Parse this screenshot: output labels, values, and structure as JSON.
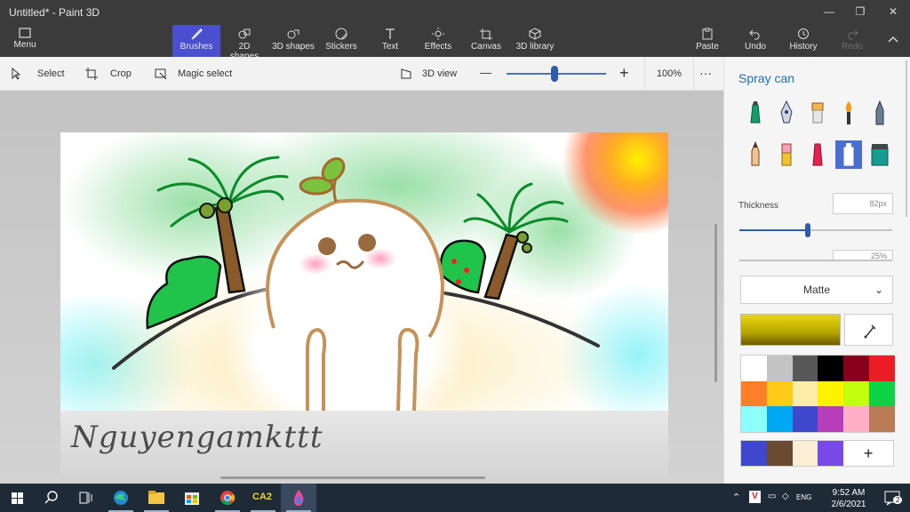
{
  "window": {
    "title": "Untitled* - Paint 3D"
  },
  "ribbon": {
    "menu": "Menu",
    "tabs": [
      {
        "id": "brushes",
        "label": "Brushes"
      },
      {
        "id": "2d-shapes",
        "label": "2D shapes"
      },
      {
        "id": "3d-shapes",
        "label": "3D shapes"
      },
      {
        "id": "stickers",
        "label": "Stickers"
      },
      {
        "id": "text",
        "label": "Text"
      },
      {
        "id": "effects",
        "label": "Effects"
      },
      {
        "id": "canvas",
        "label": "Canvas"
      },
      {
        "id": "3d-library",
        "label": "3D library"
      }
    ],
    "actions": [
      {
        "id": "paste",
        "label": "Paste"
      },
      {
        "id": "undo",
        "label": "Undo"
      },
      {
        "id": "history",
        "label": "History"
      },
      {
        "id": "redo",
        "label": "Redo"
      }
    ]
  },
  "toolbar": {
    "select": "Select",
    "crop": "Crop",
    "magic_select": "Magic select",
    "view_3d": "3D view",
    "zoom_out": "—",
    "zoom_in": "+",
    "zoom_level": "100%",
    "zoom_fraction": 0.48,
    "more": "···"
  },
  "panel": {
    "title": "Spray can",
    "thickness_label": "Thickness",
    "thickness_value": "82px",
    "thickness_fraction": 0.45,
    "opacity_value": "25%",
    "finish": "Matte",
    "current_color": "#e8d60a",
    "palette": [
      "#ffffff",
      "#c3c3c3",
      "#585858",
      "#000000",
      "#88001b",
      "#ec1c24",
      "#ff7f27",
      "#ffca18",
      "#fdeca6",
      "#fff200",
      "#c4ff0e",
      "#0ed145",
      "#8cfffb",
      "#00a8f3",
      "#3f48cc",
      "#b83dba",
      "#ffaec8",
      "#b97a56"
    ],
    "custom_palette": [
      "#3f48cc",
      "#6b4a32",
      "#fdeed6",
      "#7a4ae8"
    ],
    "add_color": "+"
  },
  "canvas": {
    "signature": "Nguyengamkttt"
  },
  "taskbar": {
    "language": "ENG",
    "time": "9:52 AM",
    "date": "2/6/2021",
    "notifications": "2",
    "ca2_label": "CA2"
  }
}
